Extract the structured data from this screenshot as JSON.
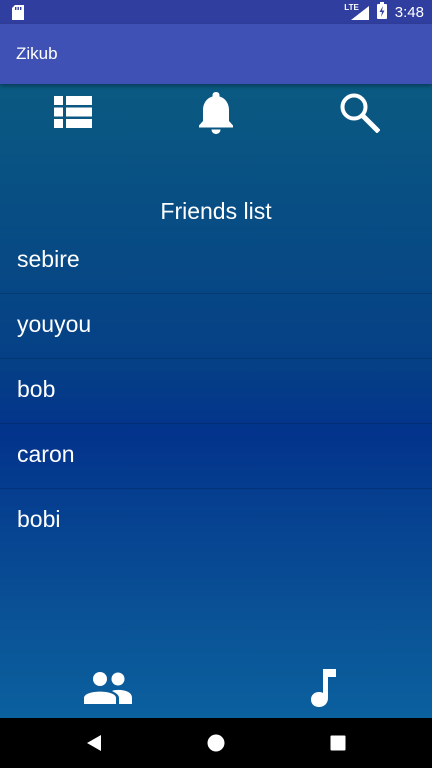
{
  "status_bar": {
    "network": "LTE",
    "time": "3:48"
  },
  "app_bar": {
    "title": "Zikub"
  },
  "top_toolbar": {
    "icons": [
      "list-icon",
      "bell-icon",
      "search-icon"
    ]
  },
  "friends": {
    "heading": "Friends list",
    "items": [
      "sebire",
      "youyou",
      "bob",
      "caron",
      "bobi"
    ]
  },
  "bottom_toolbar": {
    "icons": [
      "people-icon",
      "music-note-icon"
    ]
  },
  "nav_bar": {
    "icons": [
      "back-icon",
      "home-icon",
      "recents-icon"
    ]
  },
  "colors": {
    "status_bar": "#303F9F",
    "app_bar": "#3F51B5",
    "content_top": "#0a5a82",
    "content_mid": "#03338c",
    "content_bottom": "#0b609e"
  }
}
